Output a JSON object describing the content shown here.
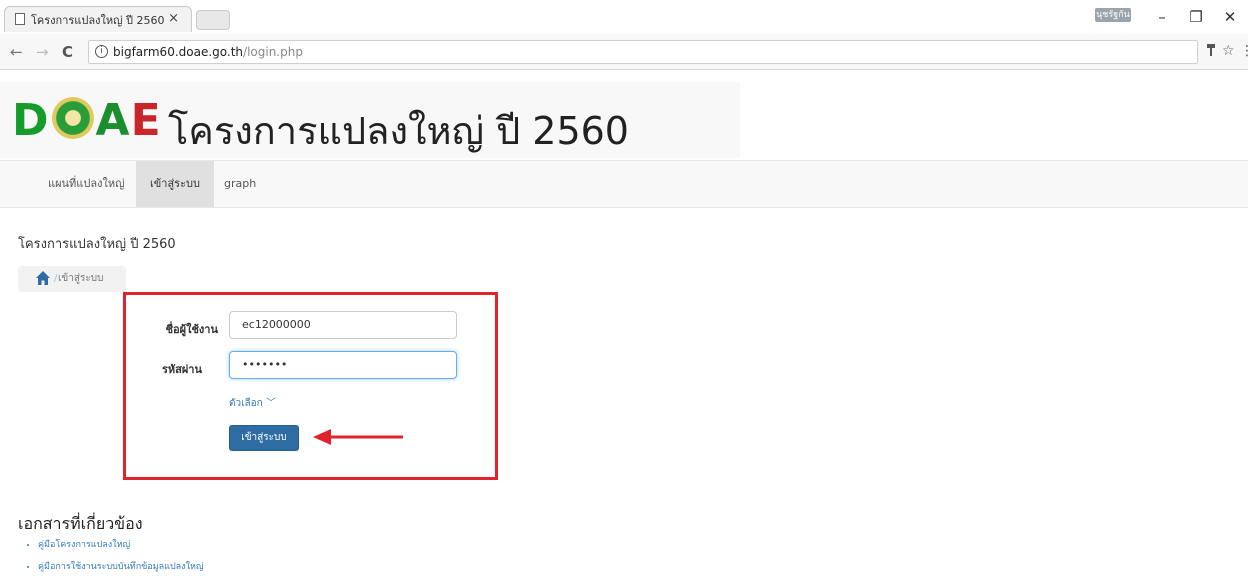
{
  "browser": {
    "tab_title": "โครงการแปลงใหญ่ ปี 2560",
    "tab_close": "×",
    "user_badge": "นุชรัฐกัน",
    "minimize": "–",
    "restore": "❐",
    "close": "✕",
    "back": "←",
    "forward": "→",
    "reload": "C",
    "url_host": "bigfarm60.doae.go.th",
    "url_path": "/login.php"
  },
  "header": {
    "logo_text": [
      "D",
      "A",
      "E"
    ],
    "site_title": "โครงการแปลงใหญ่ ปี 2560"
  },
  "navbar": {
    "items": [
      {
        "label": "แผนที่แปลงใหญ่"
      },
      {
        "label": "เข้าสู่ระบบ"
      },
      {
        "label": "graph"
      }
    ]
  },
  "main": {
    "heading": "โครงการแปลงใหญ่ ปี 2560",
    "breadcrumb": {
      "current": "เข้าสู่ระบบ"
    }
  },
  "login_form": {
    "username_label": "ชื่อผู้ใช้งาน",
    "username_value": "ec12000000",
    "password_label": "รหัสผ่าน",
    "password_value": "•••••••",
    "options_label": "ตัวเลือก ﹀",
    "submit_label": "เข้าสู่ระบบ"
  },
  "documents": {
    "title": "เอกสารที่เกี่ยวข้อง",
    "items": [
      {
        "label": "คู่มือโครงการแปลงใหญ่"
      },
      {
        "label": "คู่มือการใช้งานระบบบันทึกข้อมูลแปลงใหญ่"
      }
    ]
  },
  "colors": {
    "primary_button": "#2e6da4",
    "highlight_box": "#e0242c",
    "link": "#337ab7"
  }
}
